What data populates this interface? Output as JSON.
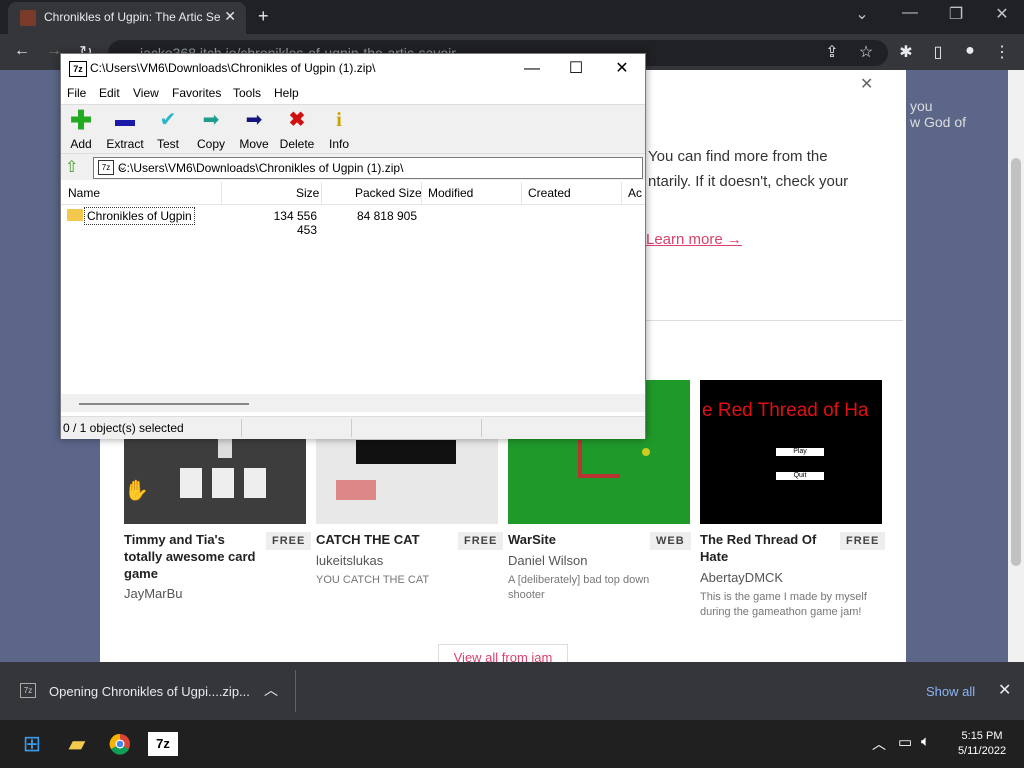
{
  "browser": {
    "tab_title": "Chronikles of Ugpin: The Artic Se",
    "url": "jacko368.itch.io/chronikles-of-ugpin-the-artic-savoir"
  },
  "page": {
    "info_line1": "You can find more from the",
    "info_line2": "ntarily. If it doesn't, check your",
    "learn_more": "Learn more →",
    "right_text1": "you",
    "right_text2": "w God of",
    "view_all": "View all from jam",
    "games": [
      {
        "title": "Timmy and Tia's totally awesome card game",
        "badge": "FREE",
        "author": "JayMarBu",
        "desc": ""
      },
      {
        "title": "CATCH THE CAT",
        "badge": "FREE",
        "author": "lukeitslukas",
        "desc": "YOU CATCH THE CAT"
      },
      {
        "title": "WarSite",
        "badge": "WEB",
        "author": "Daniel Wilson",
        "desc": "A [deliberately] bad top down shooter"
      },
      {
        "title": "The Red Thread Of Hate",
        "badge": "FREE",
        "author": "AbertayDMCK",
        "desc": "This is the game I made by myself during the gameathon game jam!"
      }
    ],
    "thumb4_text": "e Red Thread of Ha",
    "thumb4_play": "Play",
    "thumb4_quit": "Quit"
  },
  "zip": {
    "title": "C:\\Users\\VM6\\Downloads\\Chronikles of Ugpin (1).zip\\",
    "menu": [
      "File",
      "Edit",
      "View",
      "Favorites",
      "Tools",
      "Help"
    ],
    "tools": [
      {
        "label": "Add",
        "icon": "plus-icon",
        "color": "#22aa22"
      },
      {
        "label": "Extract",
        "icon": "minus-icon",
        "color": "#1a1aa8"
      },
      {
        "label": "Test",
        "icon": "check-icon",
        "color": "#2bb5c8"
      },
      {
        "label": "Copy",
        "icon": "copy-arrow-icon",
        "color": "#1f9c8c"
      },
      {
        "label": "Move",
        "icon": "move-arrow-icon",
        "color": "#14147a"
      },
      {
        "label": "Delete",
        "icon": "x-icon",
        "color": "#d01010"
      },
      {
        "label": "Info",
        "icon": "info-icon",
        "color": "#c8a400"
      }
    ],
    "path": "C:\\Users\\VM6\\Downloads\\Chronikles of Ugpin (1).zip\\",
    "columns": [
      "Name",
      "Size",
      "Packed Size",
      "Modified",
      "Created",
      "Ac"
    ],
    "rows": [
      {
        "name": "Chronikles of Ugpin",
        "size": "134 556 453",
        "packed": "84 818 905"
      }
    ],
    "status": "0 / 1 object(s) selected"
  },
  "downloads": {
    "item": "Opening Chronikles of Ugpi....zip...",
    "show_all": "Show all"
  },
  "taskbar": {
    "time": "5:15 PM",
    "date": "5/11/2022"
  }
}
